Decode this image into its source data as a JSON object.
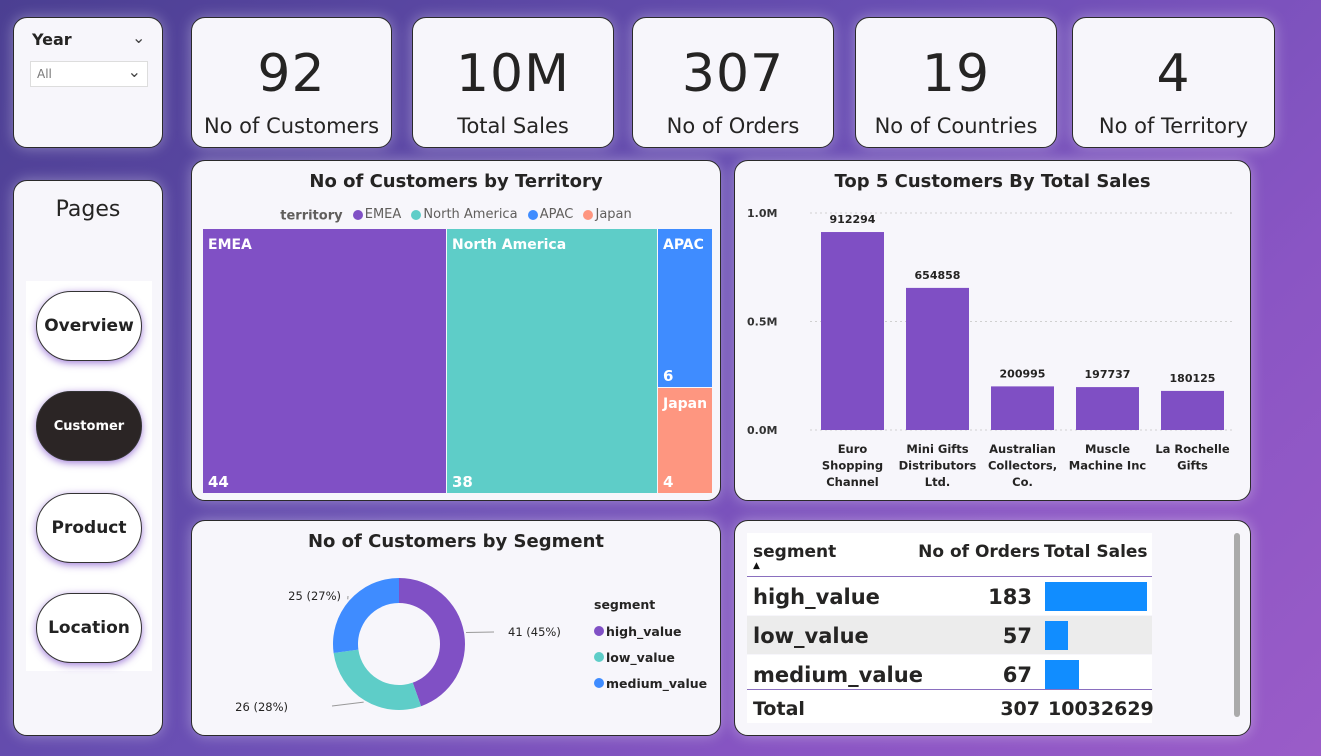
{
  "slicer": {
    "label": "Year",
    "value": "All"
  },
  "kpis": [
    {
      "value": "92",
      "label": "No of Customers"
    },
    {
      "value": "10M",
      "label": "Total Sales"
    },
    {
      "value": "307",
      "label": "No of Orders"
    },
    {
      "value": "19",
      "label": "No of Countries"
    },
    {
      "value": "4",
      "label": "No of Territory"
    }
  ],
  "nav": {
    "title": "Pages",
    "items": [
      "Overview",
      "Customer",
      "Product",
      "Location"
    ],
    "active": "Customer"
  },
  "treemap": {
    "title": "No of Customers by Territory",
    "legend_title": "territory",
    "items": [
      {
        "name": "EMEA",
        "value": "44",
        "color": "#8050c5"
      },
      {
        "name": "North America",
        "value": "38",
        "color": "#5ecdc8"
      },
      {
        "name": "APAC",
        "value": "6",
        "color": "#3f8cff"
      },
      {
        "name": "Japan",
        "value": "4",
        "color": "#fe9680"
      }
    ]
  },
  "chart_data": [
    {
      "type": "bar",
      "title": "Top 5 Customers By Total Sales",
      "categories": [
        "Euro Shopping Channel",
        "Mini Gifts Distributors Ltd.",
        "Australian Collectors, Co.",
        "Muscle Machine Inc",
        "La Rochelle Gifts"
      ],
      "category_lines": [
        [
          "Euro",
          "Shopping",
          "Channel"
        ],
        [
          "Mini Gifts",
          "Distributors",
          "Ltd."
        ],
        [
          "Australian",
          "Collectors,",
          "Co."
        ],
        [
          "Muscle",
          "Machine Inc"
        ],
        [
          "La Rochelle",
          "Gifts"
        ]
      ],
      "values": [
        912294,
        654858,
        200995,
        197737,
        180125
      ],
      "yticks": [
        "0.0M",
        "0.5M",
        "1.0M"
      ],
      "ylim": [
        0,
        1000000
      ],
      "color": "#7f4fc4",
      "grid": true
    },
    {
      "type": "pie",
      "title": "No of Customers by Segment",
      "legend_title": "segment",
      "categories": [
        "high_value",
        "low_value",
        "medium_value"
      ],
      "values": [
        41,
        26,
        25
      ],
      "labels": [
        "41 (45%)",
        "26 (28%)",
        "25 (27%)"
      ],
      "colors": [
        "#8050c5",
        "#5ecdc8",
        "#3f8cff"
      ]
    }
  ],
  "table": {
    "headers": [
      "segment",
      "No of Orders",
      "Total Sales"
    ],
    "rows": [
      {
        "segment": "high_value",
        "orders": "183",
        "sales_fraction": 0.75
      },
      {
        "segment": "low_value",
        "orders": "57",
        "sales_fraction": 0.17
      },
      {
        "segment": "medium_value",
        "orders": "67",
        "sales_fraction": 0.25
      }
    ],
    "total": {
      "label": "Total",
      "orders": "307",
      "sales": "10032629"
    },
    "bar_color": "#118dff"
  }
}
